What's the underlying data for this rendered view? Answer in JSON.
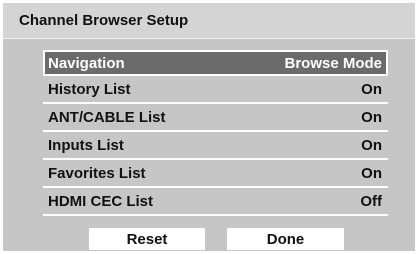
{
  "dialog": {
    "title": "Channel Browser Setup"
  },
  "menu": {
    "items": [
      {
        "label": "Navigation",
        "value": "Browse Mode"
      },
      {
        "label": "History List",
        "value": "On"
      },
      {
        "label": "ANT/CABLE List",
        "value": "On"
      },
      {
        "label": "Inputs List",
        "value": "On"
      },
      {
        "label": "Favorites List",
        "value": "On"
      },
      {
        "label": "HDMI CEC List",
        "value": "Off"
      }
    ]
  },
  "buttons": {
    "reset": "Reset",
    "done": "Done"
  },
  "colors": {
    "panel_bg": "#c6c6c6",
    "selected_bg": "#6b6b6b",
    "separator": "#ffffff"
  }
}
